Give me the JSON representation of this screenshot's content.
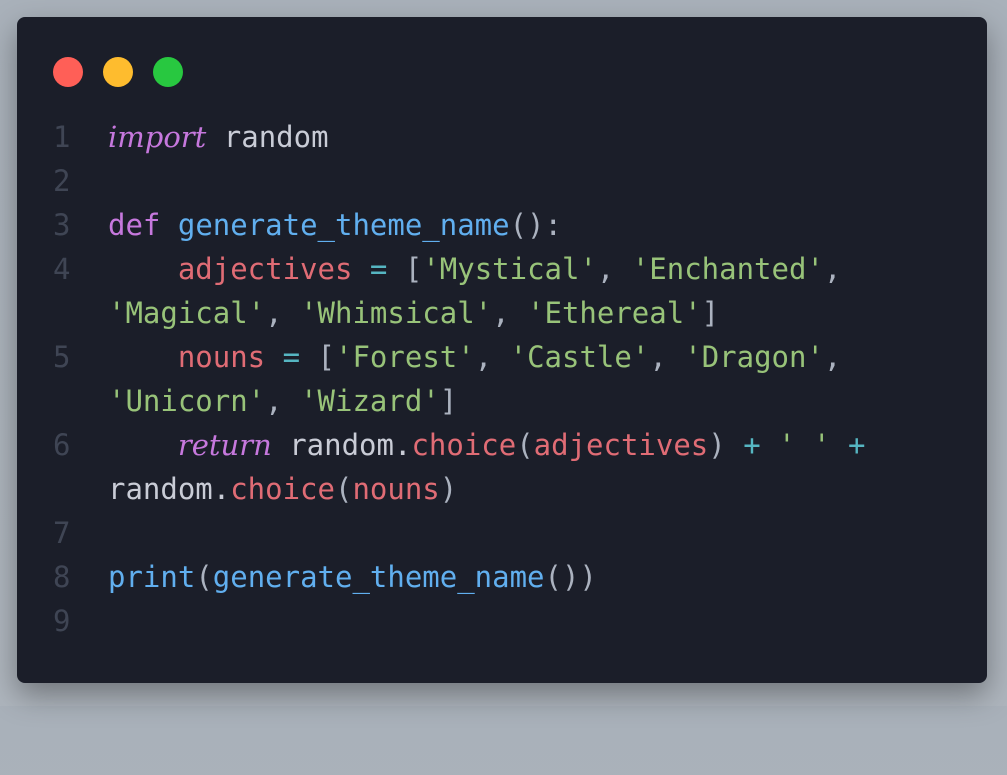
{
  "window": {
    "controls": {
      "close_color": "#ff5f57",
      "minimize_color": "#febc2e",
      "maximize_color": "#28c840"
    }
  },
  "code": {
    "line_numbers": [
      "1",
      "2",
      "3",
      "4",
      "5",
      "6",
      "7",
      "8",
      "9"
    ],
    "l1": {
      "kw": "import",
      "rest": " random"
    },
    "l3": {
      "kw": "def",
      "sp": " ",
      "fn": "generate_theme_name",
      "punc": "():"
    },
    "l4": {
      "indent": "    ",
      "var": "adjectives",
      "eq": " = ",
      "open": "[",
      "s1": "'Mystical'",
      "c1": ", ",
      "s2": "'Enchanted'",
      "c2": ", ",
      "s3": "'Magical'",
      "c3": ", ",
      "s4": "'Whimsical'",
      "c4": ", ",
      "s5": "'Ethereal'",
      "close": "]"
    },
    "l5": {
      "indent": "    ",
      "var": "nouns",
      "eq": " = ",
      "open": "[",
      "s1": "'Forest'",
      "c1": ", ",
      "s2": "'Castle'",
      "c2": ", ",
      "s3": "'Dragon'",
      "c3": ", ",
      "s4": "'Unicorn'",
      "c4": ", ",
      "s5": "'Wizard'",
      "close": "]"
    },
    "l6": {
      "indent": "    ",
      "kw": "return",
      "mod1": " random.",
      "fn1": "choice",
      "p1": "(",
      "arg1": "adjectives",
      "p2": ")",
      "plus1": " + ",
      "space_str": "' '",
      "plus2": " + ",
      "mod2": "random.",
      "fn2": "choice",
      "p3": "(",
      "arg2": "nouns",
      "p4": ")"
    },
    "l8": {
      "fn": "print",
      "p1": "(",
      "fn2": "generate_theme_name",
      "p2": "())"
    }
  }
}
